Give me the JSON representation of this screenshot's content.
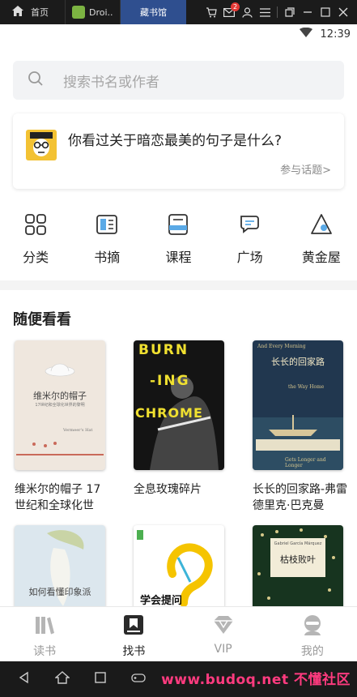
{
  "topbar": {
    "home_label": "首页",
    "app_tab_label": "Droi..",
    "active_tab_label": "藏书馆",
    "mail_badge": "2",
    "icons": [
      "home-icon",
      "android-app-icon",
      "cart-icon",
      "mail-icon",
      "user-icon",
      "menu-icon",
      "restore-icon",
      "minimize-icon",
      "maximize-icon",
      "close-icon"
    ]
  },
  "status": {
    "time": "12:39",
    "icons": [
      "wifi-icon"
    ]
  },
  "search": {
    "placeholder": "搜索书名或作者",
    "icon": "search-icon"
  },
  "topic": {
    "question": "你看过关于暗恋最美的句子是什么?",
    "action": "参与话题>"
  },
  "categories": [
    {
      "label": "分类",
      "icon": "grid-icon"
    },
    {
      "label": "书摘",
      "icon": "excerpt-icon"
    },
    {
      "label": "课程",
      "icon": "course-icon"
    },
    {
      "label": "广场",
      "icon": "chat-icon"
    },
    {
      "label": "黄金屋",
      "icon": "gold-house-icon"
    }
  ],
  "section": {
    "title": "随便看看"
  },
  "books": [
    {
      "title": "维米尔的帽子 17世纪和全球化世",
      "cover_title": "维米尔的帽子",
      "cover_sub": "17世纪和全球化世界的黎明",
      "cover_en": "Vermeer's Hat"
    },
    {
      "title": "全息玫瑰碎片",
      "cover_line1": "BURN",
      "cover_line2": "-ING",
      "cover_line3": "CHROME"
    },
    {
      "title": "长长的回家路-弗雷德里克·巴克曼",
      "cover_en_top": "And Every Morning",
      "cover_title": "长长的回家路",
      "cover_en_mid": "the Way Home",
      "cover_en_bottom": "Gets Longer and Longer"
    },
    {
      "title": "",
      "cover_text": "如何看懂印象派"
    },
    {
      "title": "",
      "cover_text": "学会提问"
    },
    {
      "title": "",
      "cover_en": "Gabriel García Márquez",
      "cover_title": "枯枝败叶"
    }
  ],
  "bottom_nav": [
    {
      "label": "读书",
      "icon": "books-icon",
      "active": false
    },
    {
      "label": "找书",
      "icon": "bookmark-book-icon",
      "active": true
    },
    {
      "label": "VIP",
      "icon": "diamond-icon",
      "active": false
    },
    {
      "label": "我的",
      "icon": "profile-icon",
      "active": false
    }
  ],
  "watermark": "www.budoq.net 不懂社区",
  "colors": {
    "accent_tab": "#2f4f8f",
    "badge": "#e53935",
    "watermark": "#ff3b7f"
  }
}
